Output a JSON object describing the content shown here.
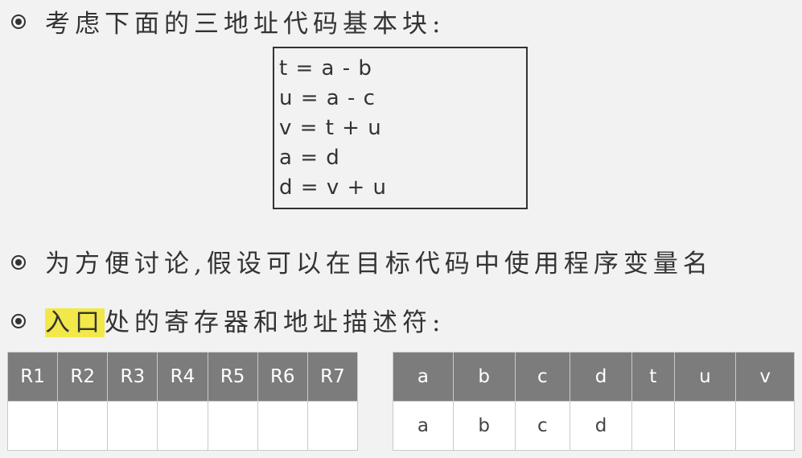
{
  "bullets": [
    "考虑下面的三地址代码基本块:",
    "为方便讨论,假设可以在目标代码中使用程序变量名",
    {
      "highlight": "入口",
      "rest": "处的寄存器和地址描述符:"
    }
  ],
  "code_lines": [
    "t = a - b",
    "u = a - c",
    "v = t + u",
    "a = d",
    "d = v + u"
  ],
  "register_table": {
    "headers": [
      "R1",
      "R2",
      "R3",
      "R4",
      "R5",
      "R6",
      "R7"
    ],
    "row": [
      "",
      "",
      "",
      "",
      "",
      "",
      ""
    ]
  },
  "address_table": {
    "headers": [
      "a",
      "b",
      "c",
      "d",
      "t",
      "u",
      "v"
    ],
    "row": [
      "a",
      "b",
      "c",
      "d",
      "",
      "",
      ""
    ]
  },
  "colors": {
    "header_bg": "#7c7c7c",
    "highlight": "#f2e84a",
    "background": "#f2f2f3"
  },
  "icons": {
    "bullet": "circle-bullet-icon"
  }
}
